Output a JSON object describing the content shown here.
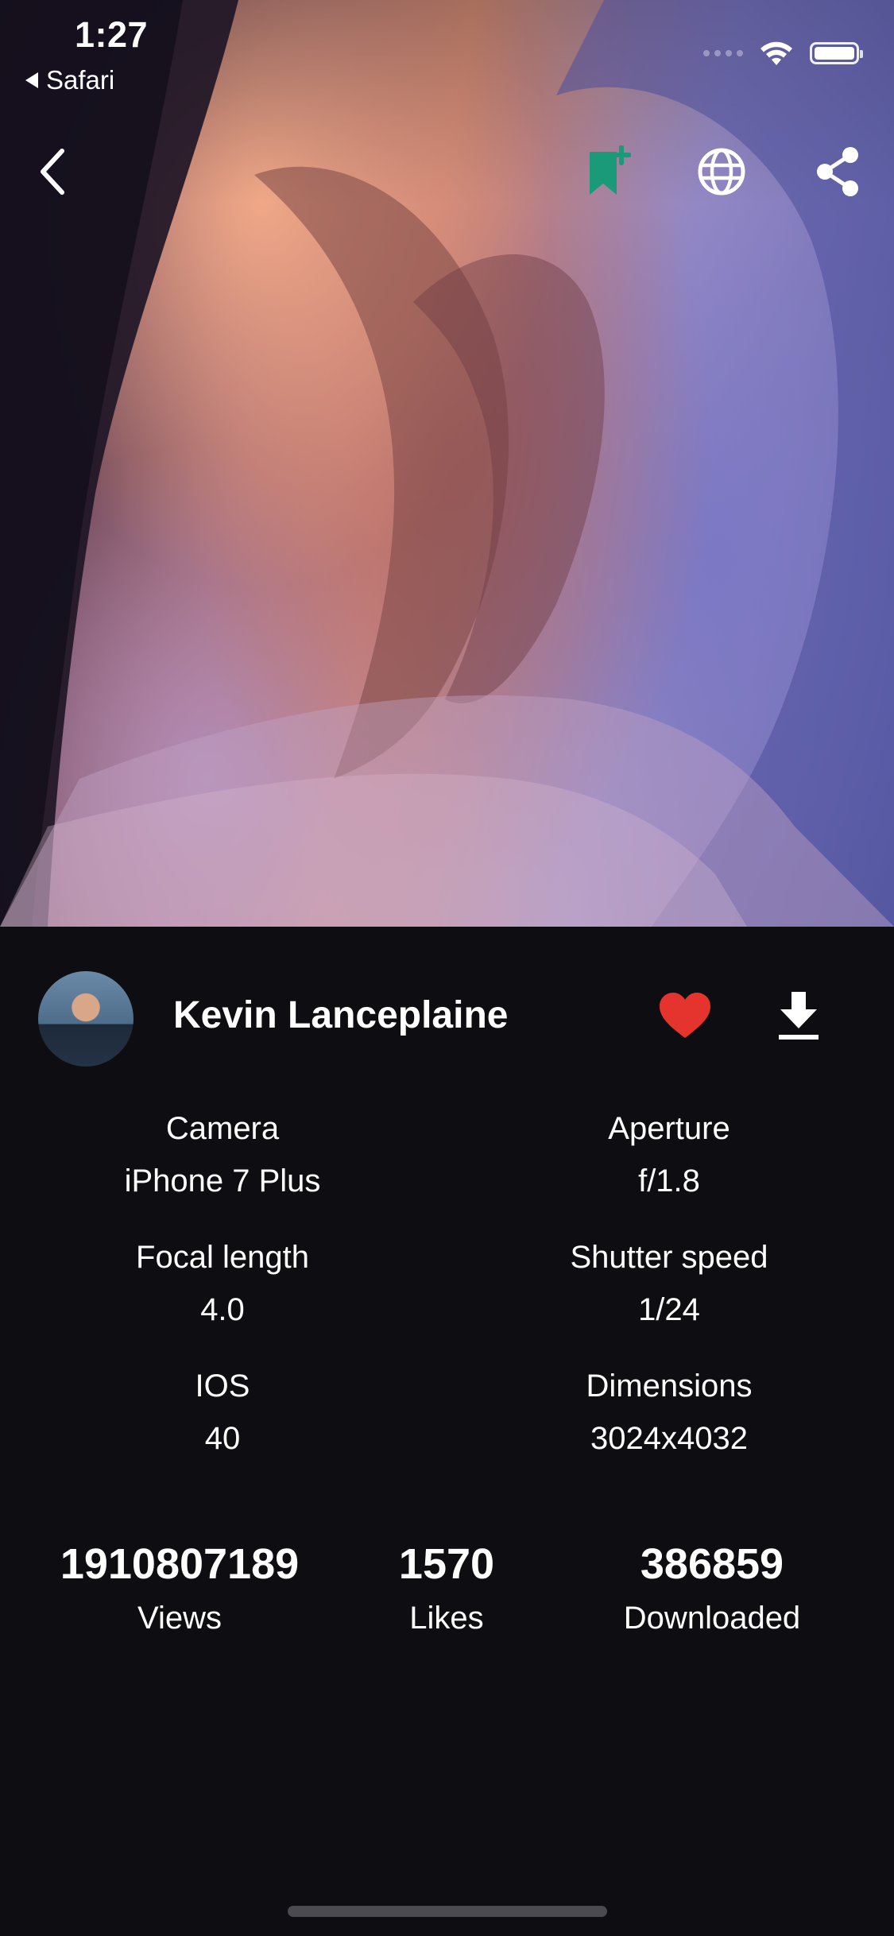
{
  "status_bar": {
    "time": "1:27",
    "back_app": "Safari"
  },
  "photo": {
    "description_colors": [
      "#3a2640",
      "#d58b74",
      "#9b8ec6",
      "#5e60a6"
    ]
  },
  "toolbar": {
    "icons": [
      "back-chevron-icon",
      "bookmark-add-icon",
      "globe-icon",
      "share-icon"
    ],
    "bookmark_color": "#1b9a7a"
  },
  "author": {
    "name": "Kevin Lanceplaine"
  },
  "actions": {
    "like_color": "#e5342e"
  },
  "specs": [
    {
      "label": "Camera",
      "value": "iPhone 7 Plus"
    },
    {
      "label": "Aperture",
      "value": "f/1.8"
    },
    {
      "label": "Focal length",
      "value": "4.0"
    },
    {
      "label": "Shutter speed",
      "value": "1/24"
    },
    {
      "label": "IOS",
      "value": "40"
    },
    {
      "label": "Dimensions",
      "value": "3024x4032"
    }
  ],
  "stats": [
    {
      "value": "1910807189",
      "label": "Views"
    },
    {
      "value": "1570",
      "label": "Likes"
    },
    {
      "value": "386859",
      "label": "Downloaded"
    }
  ]
}
